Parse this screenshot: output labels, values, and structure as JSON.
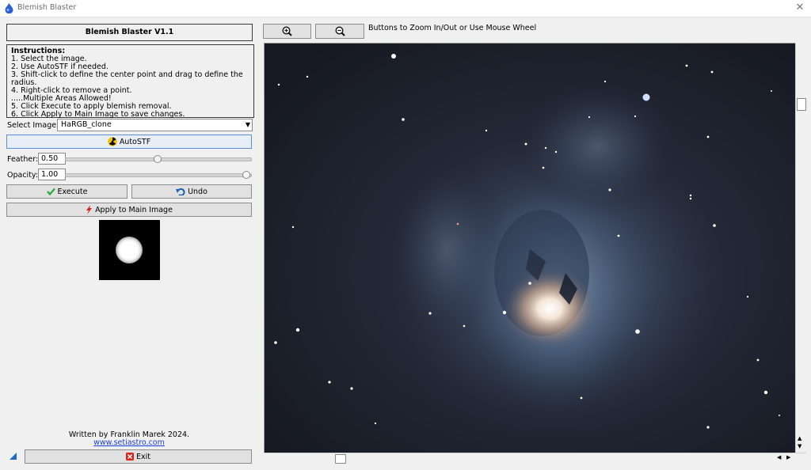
{
  "window": {
    "title": "Blemish Blaster"
  },
  "heading": "Blemish Blaster V1.1",
  "instructions": {
    "title": "Instructions:",
    "lines": [
      "1. Select the image.",
      "2. Use AutoSTF if needed.",
      "3. Shift-click to define the center point and drag to define the radius.",
      "4. Right-click to remove a point.",
      ".....Multiple Areas Allowed!",
      "5. Click Execute to apply blemish removal.",
      "6. Click Apply to Main Image to save changes."
    ]
  },
  "select_image": {
    "label": "Select Image:",
    "value": "HaRGB_clone"
  },
  "buttons": {
    "autostf": "AutoSTF",
    "execute": "Execute",
    "undo": "Undo",
    "apply": "Apply to Main Image",
    "exit": "Exit"
  },
  "feather": {
    "label": "Feather:",
    "value": "0.50",
    "level": 0.5
  },
  "opacity": {
    "label": "Opacity:",
    "value": "1.00",
    "level": 1.0
  },
  "credit": {
    "author": "Written by Franklin Marek 2024.",
    "link": "www.setiastro.com"
  },
  "zoom": {
    "hint": "Buttons to Zoom In/Out or Use Mouse Wheel"
  },
  "icons": [
    "app-icon",
    "close-icon",
    "radiation-icon",
    "checkmark-icon",
    "undo-icon",
    "lightning-icon",
    "exit-icon",
    "zoom-in-icon",
    "zoom-out-icon",
    "size-grip-icon"
  ]
}
